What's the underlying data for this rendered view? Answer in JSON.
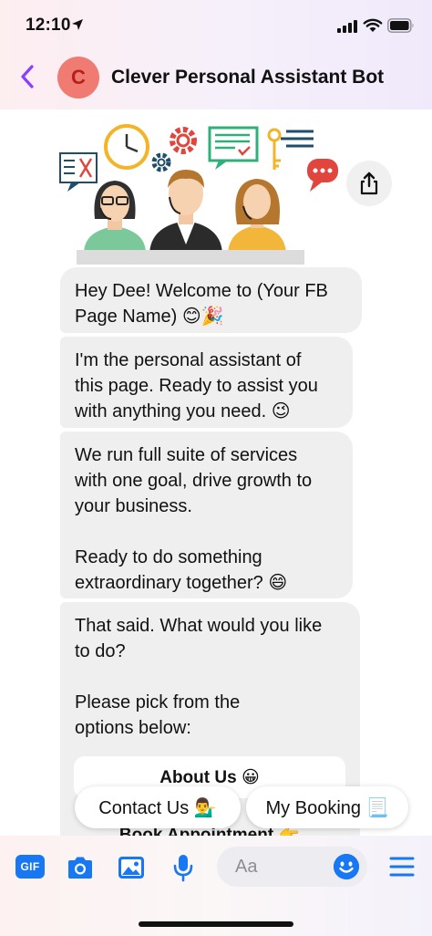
{
  "status_bar": {
    "time": "12:10"
  },
  "header": {
    "avatar_letter": "C",
    "bot_name": "Clever Personal Assistant Bot"
  },
  "messages": [
    {
      "text": "Hey Dee! Welcome to (Your FB\nPage Name) 😊🎉"
    },
    {
      "text": "I'm the personal assistant of\nthis page. Ready to assist you\nwith anything you need. 😉"
    },
    {
      "text": "We run full suite of services\nwith one goal, drive growth to\nyour business.\n\nReady to do something\nextraordinary together? 😄"
    },
    {
      "text": "That said. What would you like\nto do?\n\nPlease pick from the\noptions below:"
    }
  ],
  "options": [
    {
      "label": "About Us 😀"
    },
    {
      "label": "Book Appointment 👉"
    }
  ],
  "quick_replies": [
    {
      "label": "Contact Us 💁‍♂️"
    },
    {
      "label": "My Booking 📃"
    }
  ],
  "composer": {
    "gif_label": "GIF",
    "placeholder": "Aa"
  },
  "colors": {
    "accent": "#1877f2",
    "back_arrow": "#8a3ffc",
    "avatar_bg": "#ef7b72",
    "bubble_bg": "#efefef"
  },
  "icons": [
    "location-arrow-icon",
    "signal-icon",
    "wifi-icon",
    "battery-icon",
    "back-arrow-icon",
    "share-icon",
    "camera-icon",
    "image-icon",
    "microphone-icon",
    "emoji-icon",
    "menu-icon"
  ]
}
